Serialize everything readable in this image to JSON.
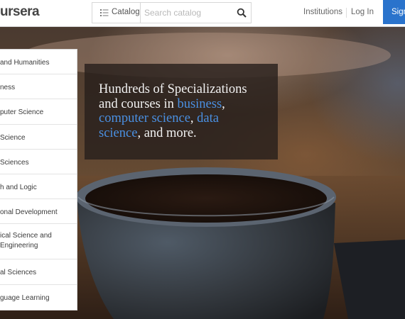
{
  "header": {
    "logo_text": "ursera",
    "catalog_label": "Catalog",
    "search_placeholder": "Search catalog",
    "institutions_label": "Institutions",
    "login_label": "Log In",
    "signup_label": "Sign"
  },
  "categories": [
    {
      "label": "and Humanities"
    },
    {
      "label": "ness"
    },
    {
      "label": "puter Science"
    },
    {
      "label": "Science"
    },
    {
      "label": "Sciences"
    },
    {
      "label": "h and Logic"
    },
    {
      "label": "onal Development"
    },
    {
      "label": "ical Science and Engineering"
    },
    {
      "label": "al Sciences"
    },
    {
      "label": "guage Learning"
    }
  ],
  "hero": {
    "tagline_lead": "Hundreds of Specializations and courses in ",
    "link_business": "business",
    "sep1": ", ",
    "link_cs": "computer science",
    "sep2": ", ",
    "link_ds": "data science",
    "tagline_tail": ", and more."
  },
  "colors": {
    "accent": "#2a73cc",
    "link": "#4a90e2"
  }
}
